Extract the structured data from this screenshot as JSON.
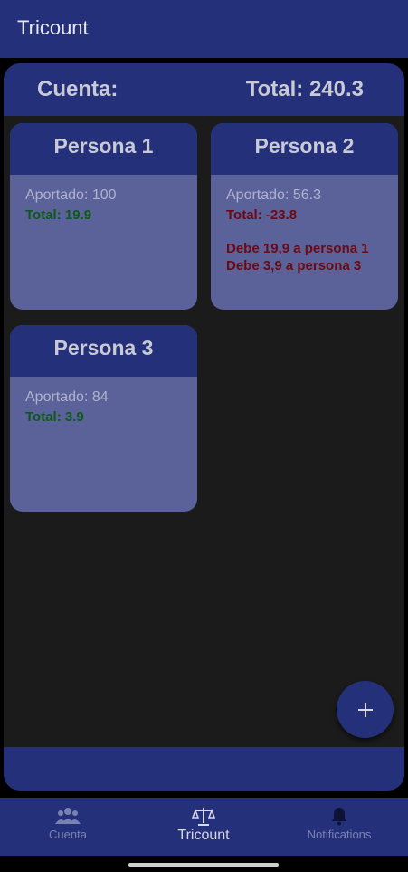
{
  "app": {
    "title": "Tricount"
  },
  "header": {
    "left": "Cuenta:",
    "right": "Total: 240.3"
  },
  "cards": [
    {
      "name": "Persona 1",
      "aportado": "Aportado: 100",
      "total": "Total: 19.9",
      "debts": []
    },
    {
      "name": "Persona 2",
      "aportado": "Aportado: 56.3",
      "total": "Total: -23.8",
      "debts": [
        "Debe 19,9 a persona 1",
        "Debe 3,9 a persona 3"
      ]
    },
    {
      "name": "Persona 3",
      "aportado": "Aportado: 84",
      "total": "Total: 3.9",
      "debts": []
    }
  ],
  "fab": {
    "icon": "plus-icon"
  },
  "nav": {
    "items": [
      {
        "label": "Cuenta",
        "icon": "group-icon",
        "active": false
      },
      {
        "label": "Tricount",
        "icon": "scale-icon",
        "active": true
      },
      {
        "label": "Notifications",
        "icon": "bell-icon",
        "active": false
      }
    ]
  },
  "colors": {
    "primary": "#25307a",
    "card": "#5a6299",
    "positive": "#0d5a18",
    "negative": "#6a0a14"
  }
}
